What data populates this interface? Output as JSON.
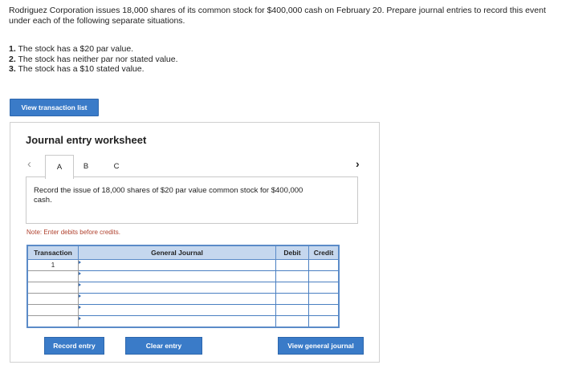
{
  "question": {
    "text": "Rodriguez Corporation issues 18,000 shares of its common stock for $400,000 cash on February 20. Prepare journal entries to record this event under each of the following separate situations."
  },
  "requirements": [
    {
      "num": "1.",
      "text": " The stock has a $20 par value."
    },
    {
      "num": "2.",
      "text": " The stock has neither par nor stated value."
    },
    {
      "num": "3.",
      "text": " The stock has a $10 stated value."
    }
  ],
  "view_transaction_button": "View transaction list",
  "worksheet": {
    "title": "Journal entry worksheet",
    "tabs": [
      "A",
      "B",
      "C"
    ],
    "active_tab": "A",
    "description": "Record the issue of 18,000 shares of $20 par value common stock for $400,000 cash.",
    "note": "Note: Enter debits before credits.",
    "table": {
      "headers": [
        "Transaction",
        "General Journal",
        "Debit",
        "Credit"
      ],
      "rows": [
        {
          "transaction": "1",
          "general_journal": "",
          "debit": "",
          "credit": ""
        },
        {
          "transaction": "",
          "general_journal": "",
          "debit": "",
          "credit": ""
        },
        {
          "transaction": "",
          "general_journal": "",
          "debit": "",
          "credit": ""
        },
        {
          "transaction": "",
          "general_journal": "",
          "debit": "",
          "credit": ""
        },
        {
          "transaction": "",
          "general_journal": "",
          "debit": "",
          "credit": ""
        },
        {
          "transaction": "",
          "general_journal": "",
          "debit": "",
          "credit": ""
        }
      ]
    },
    "buttons": {
      "record": "Record entry",
      "clear": "Clear entry",
      "view_journal": "View general journal"
    }
  },
  "icons": {
    "prev": "chevron-left-icon",
    "next": "chevron-right-icon"
  },
  "colors": {
    "button_blue": "#3a7bc8",
    "table_header": "#c5d7ee",
    "table_border": "#5b8bc8",
    "note_red": "#b0412e"
  }
}
